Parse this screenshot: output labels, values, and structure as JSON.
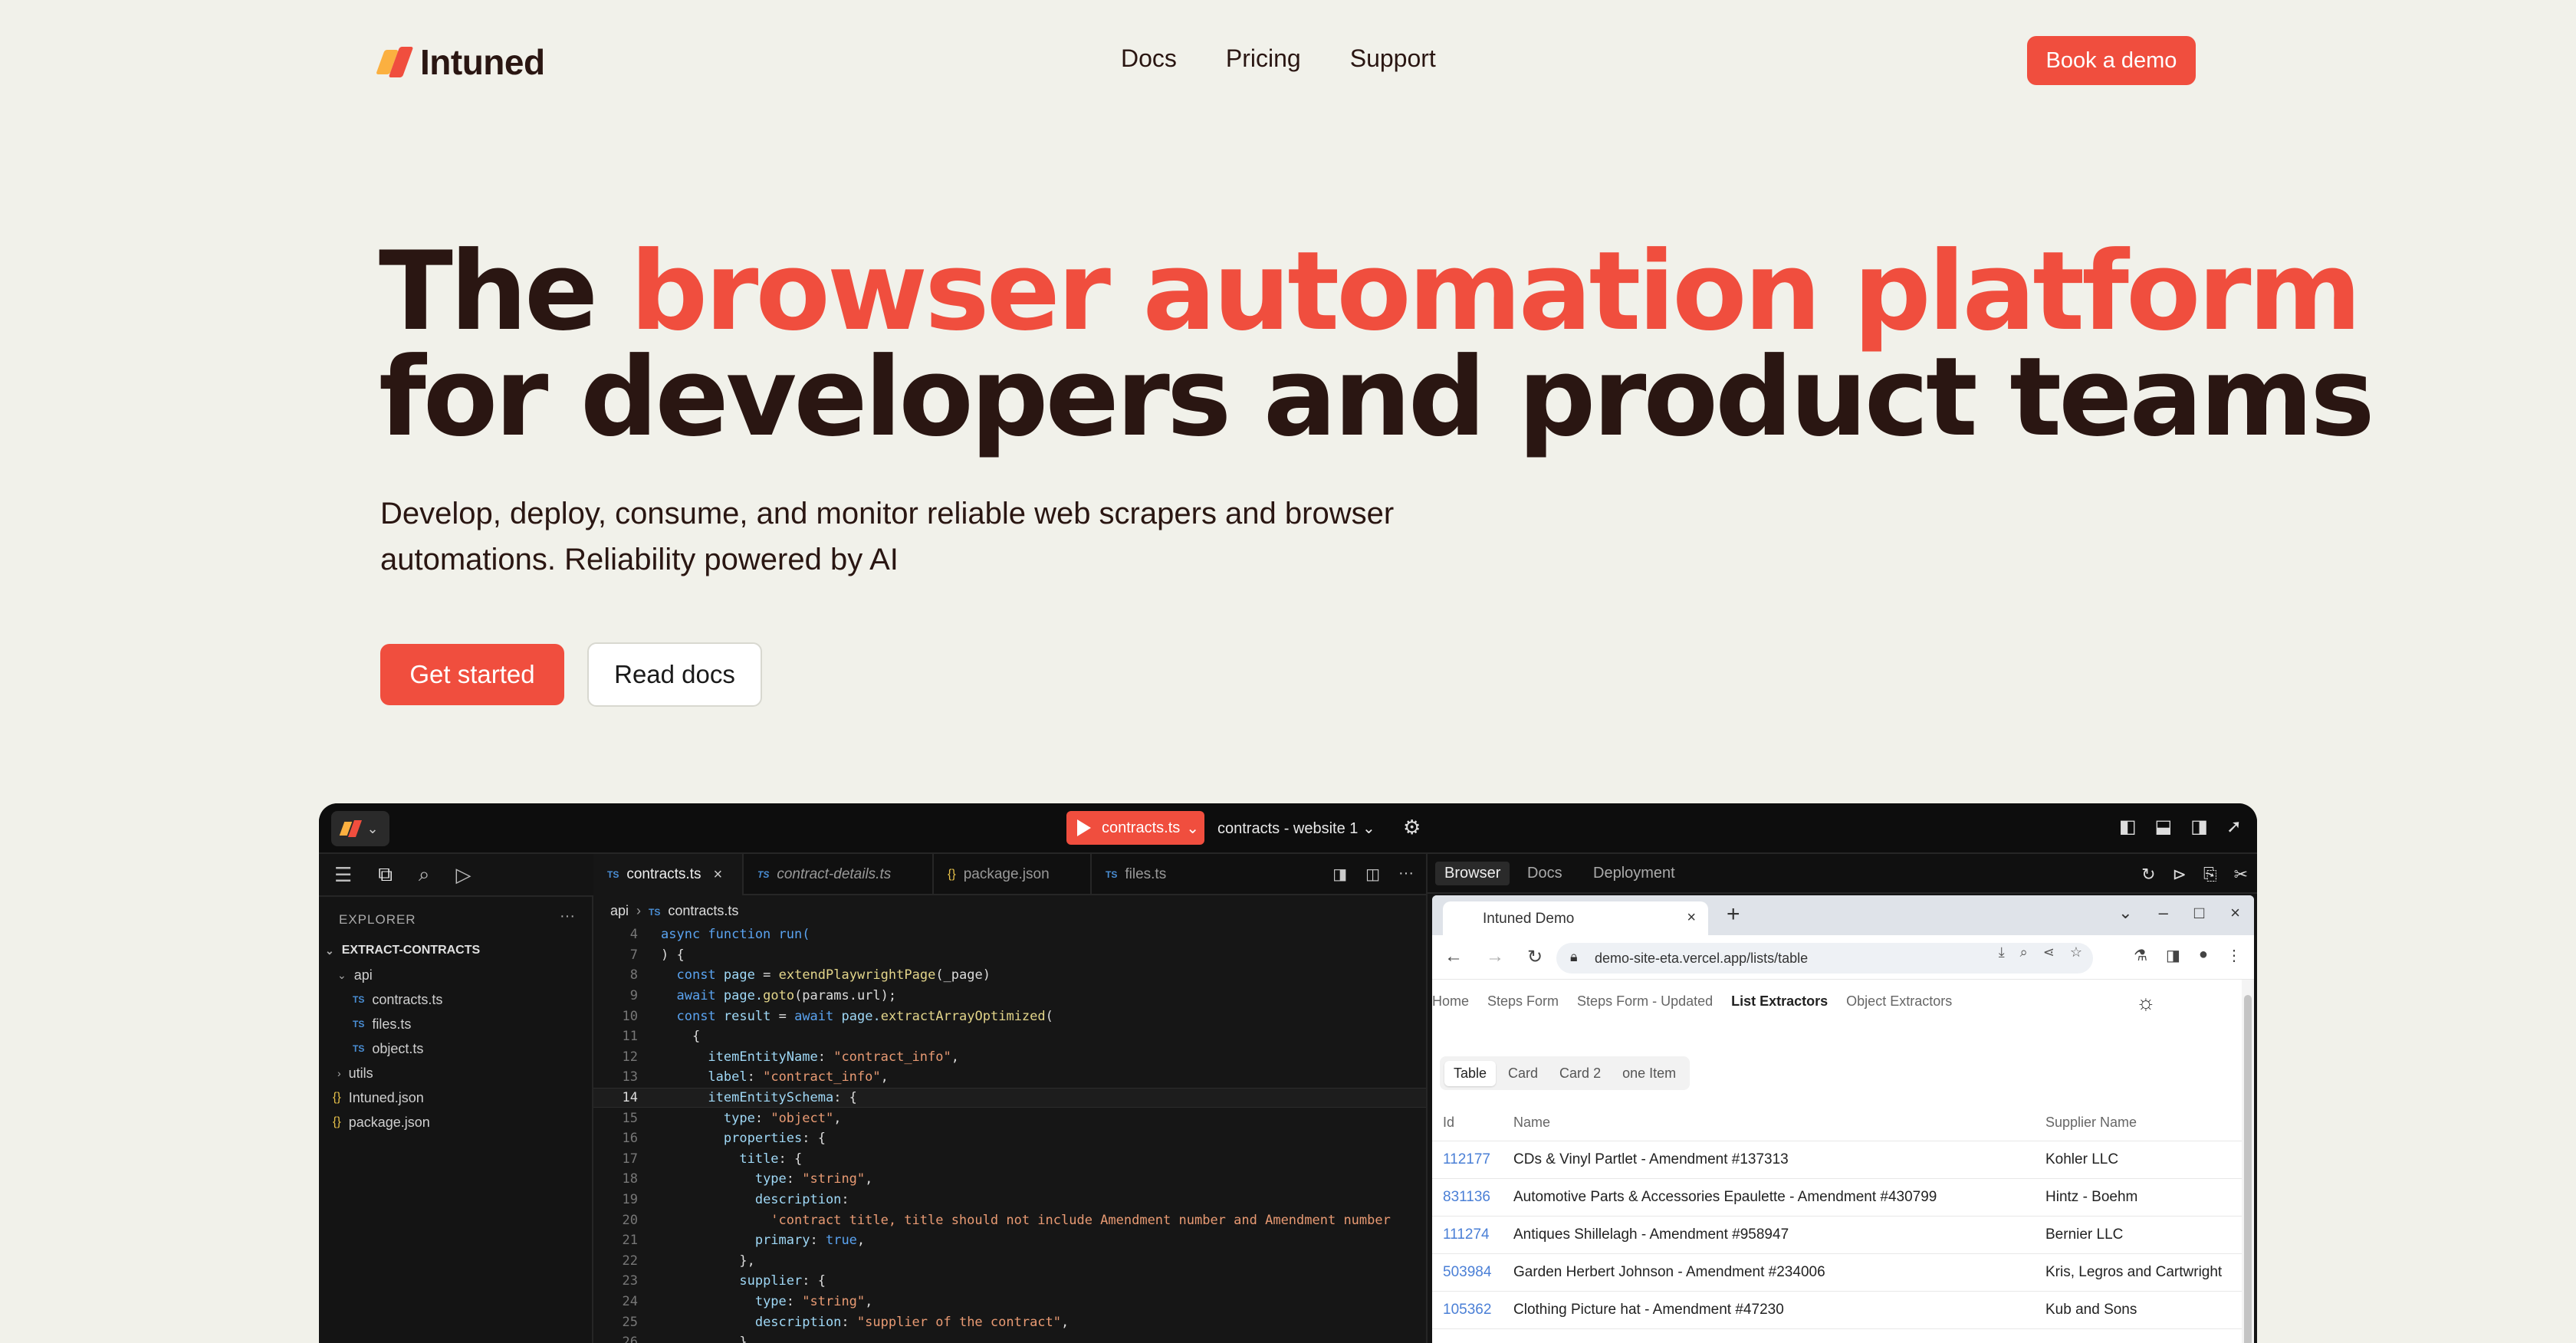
{
  "brand": {
    "name": "Intuned"
  },
  "nav": {
    "links": [
      "Docs",
      "Pricing",
      "Support"
    ],
    "cta": "Book a demo"
  },
  "hero": {
    "title_pre": "The ",
    "title_highlight": "browser automation platform",
    "title_line2": "for developers and product teams",
    "subtitle_line1": "Develop, deploy, consume, and monitor reliable web scrapers and browser",
    "subtitle_line2": "automations. Reliability powered by AI",
    "primary_cta": "Get started",
    "secondary_cta": "Read docs"
  },
  "ide": {
    "run_file": "contracts.ts",
    "run_target": "contracts - website 1 ⌄",
    "explorer_title": "EXPLORER",
    "project": "EXTRACT-CONTRACTS",
    "tree": {
      "api": "api",
      "contracts": "contracts.ts",
      "files1": "files.ts",
      "object": "object.ts",
      "utils": "utils",
      "intuned": "Intuned.json",
      "package": "package.json"
    },
    "tabs": [
      "contracts.ts",
      "contract-details.ts",
      "package.json",
      "files.ts"
    ],
    "breadcrumb": {
      "folder": "api",
      "file": "contracts.ts"
    },
    "code": {
      "l4": "async function run(",
      "l7": ") {",
      "l8a": "const",
      "l8b": "page",
      "l8c": "= ",
      "l8d": "extendPlaywrightPage",
      "l8e": "(_page)",
      "l9a": "await",
      "l9b": "page.",
      "l9c": "goto",
      "l9d": "(params.url);",
      "l10a": "const",
      "l10b": "result",
      "l10c": "= ",
      "l10d": "await",
      "l10e": "page.",
      "l10f": "extractArrayOptimized",
      "l10g": "(",
      "l11": "{",
      "l12a": "itemEntityName",
      "l12b": ": ",
      "l12c": "\"contract_info\"",
      "l12d": ",",
      "l13a": "label",
      "l13b": ": ",
      "l13c": "\"contract_info\"",
      "l13d": ",",
      "l14a": "itemEntitySchema",
      "l14b": ": {",
      "l15a": "type",
      "l15b": ": ",
      "l15c": "\"object\"",
      "l15d": ",",
      "l16a": "properties",
      "l16b": ": {",
      "l17a": "title",
      "l17b": ": {",
      "l18a": "type",
      "l18b": ": ",
      "l18c": "\"string\"",
      "l18d": ",",
      "l19a": "description",
      "l19b": ":",
      "l20": "'contract title, title should not include Amendment number and Amendment number",
      "l21a": "primary",
      "l21b": ": ",
      "l21c": "true",
      "l21d": ",",
      "l22": "},",
      "l23a": "supplier",
      "l23b": ": {",
      "l24a": "type",
      "l24b": ": ",
      "l24c": "\"string\"",
      "l24d": ",",
      "l25a": "description",
      "l25b": ": ",
      "l25c": "\"supplier of the contract\"",
      "l25d": ",",
      "l26": "},"
    },
    "browser_tabs": [
      "Browser",
      "Docs",
      "Deployment"
    ],
    "chrome": {
      "tab_title": "Intuned Demo",
      "url": "demo-site-eta.vercel.app/lists/table"
    },
    "site_nav": [
      "Home",
      "Steps Form",
      "Steps Form - Updated",
      "List Extractors",
      "Object Extractors"
    ],
    "segments": [
      "Table",
      "Card",
      "Card 2",
      "one Item"
    ],
    "table": {
      "headers": [
        "Id",
        "Name",
        "Supplier Name"
      ],
      "rows": [
        [
          "112177",
          "CDs & Vinyl Partlet - Amendment #137313",
          "Kohler LLC"
        ],
        [
          "831136",
          "Automotive Parts & Accessories Epaulette - Amendment #430799",
          "Hintz - Boehm"
        ],
        [
          "111274",
          "Antiques Shillelagh - Amendment #958947",
          "Bernier LLC"
        ],
        [
          "503984",
          "Garden Herbert Johnson - Amendment #234006",
          "Kris, Legros and Cartwright"
        ],
        [
          "105362",
          "Clothing Picture hat - Amendment #47230",
          "Kub and Sons"
        ]
      ]
    }
  }
}
